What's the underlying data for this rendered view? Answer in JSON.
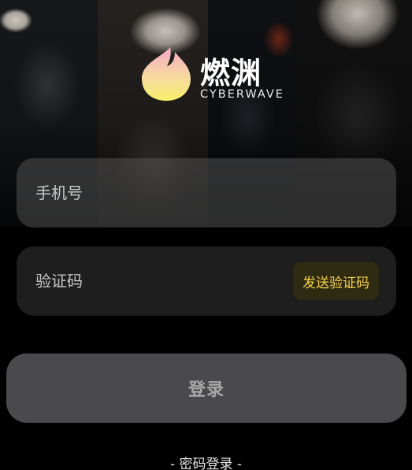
{
  "brand": {
    "name": "燃渊",
    "subtitle": "CYBERWAVE"
  },
  "form": {
    "phone_placeholder": "手机号",
    "code_placeholder": "验证码",
    "send_code_label": "发送验证码",
    "login_label": "登录"
  },
  "footer": {
    "password_login_label": "- 密码登录 -"
  },
  "colors": {
    "background": "#000000",
    "accent_text": "#f2d24a",
    "login_button": "#4a4a4c"
  }
}
